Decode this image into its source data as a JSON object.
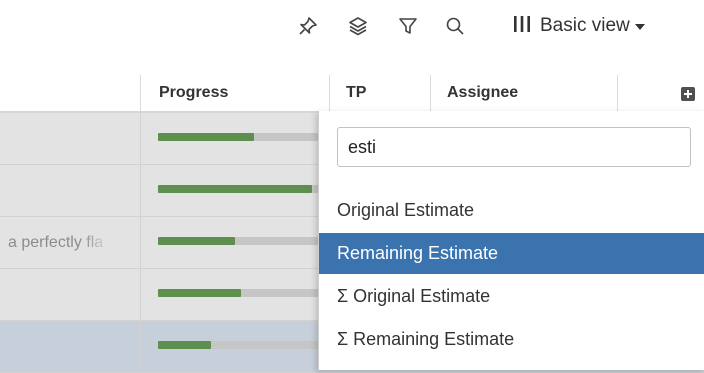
{
  "toolbar": {
    "icons": [
      "pin-icon",
      "layers-icon",
      "filter-icon",
      "search-icon",
      "columns-icon"
    ],
    "view_label": "Basic view"
  },
  "table": {
    "columns": [
      {
        "label": "Progress"
      },
      {
        "label": "TP"
      },
      {
        "label": "Assignee"
      }
    ],
    "rows": [
      {
        "summary": "",
        "progress": 0.6
      },
      {
        "summary": "",
        "progress": 0.96
      },
      {
        "summary": "a perfectly fla",
        "progress": 0.48
      },
      {
        "summary": "",
        "progress": 0.52
      },
      {
        "summary": "",
        "progress": 0.33,
        "selected": true
      }
    ]
  },
  "column_picker": {
    "search_value": "esti",
    "options": [
      {
        "label": "Original Estimate",
        "highlighted": false
      },
      {
        "label": "Remaining Estimate",
        "highlighted": true
      },
      {
        "label": "Σ Original Estimate",
        "highlighted": false
      },
      {
        "label": "Σ Remaining Estimate",
        "highlighted": false
      }
    ]
  },
  "colors": {
    "progress_fill": "#5e8f4e",
    "progress_track": "#c6c6c6",
    "highlight": "#3b73af"
  }
}
